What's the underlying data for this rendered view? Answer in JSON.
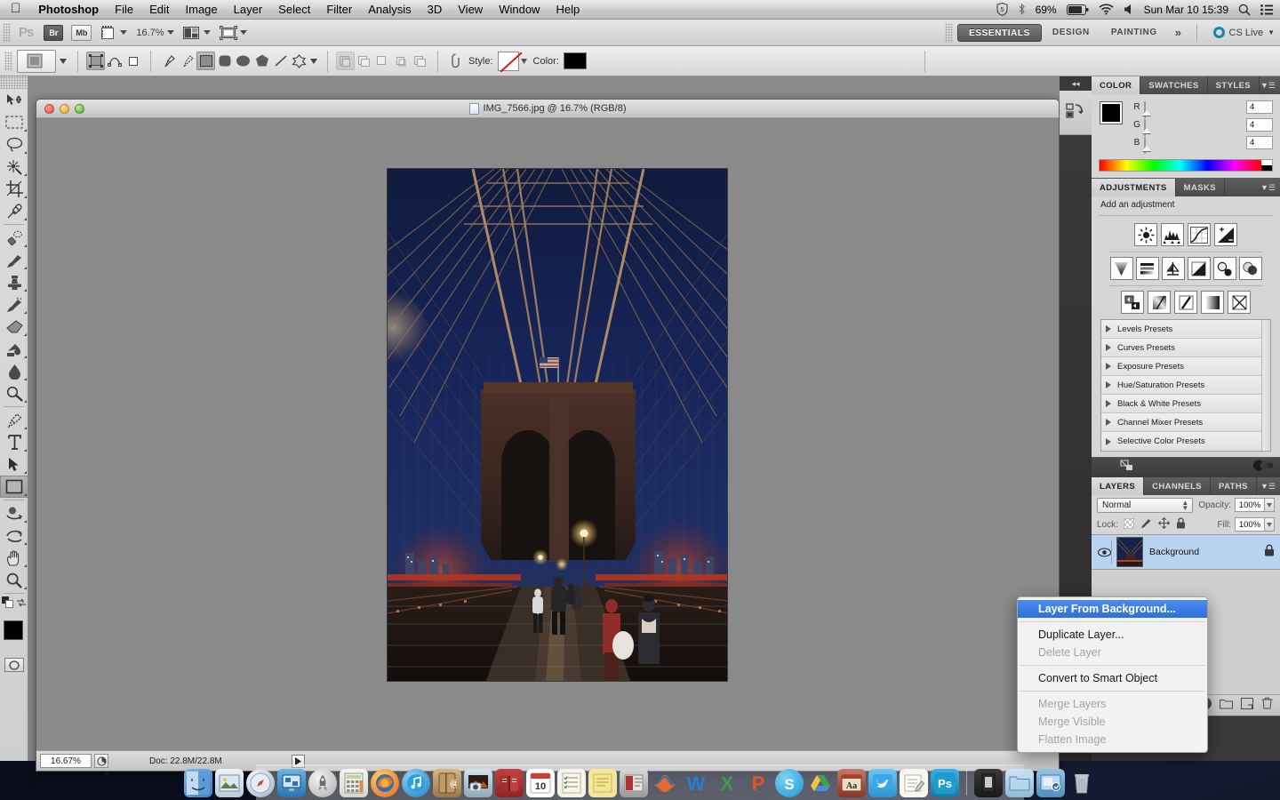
{
  "menubar": {
    "apple_icon": "apple-icon",
    "app_name": "Photoshop",
    "items": [
      "File",
      "Edit",
      "Image",
      "Layer",
      "Select",
      "Filter",
      "Analysis",
      "3D",
      "View",
      "Window",
      "Help"
    ],
    "status": {
      "shield_icon": "dropbox-shield-icon",
      "bluetooth_icon": "bluetooth-icon",
      "battery_percent": "69%",
      "battery_icon": "battery-icon",
      "wifi_icon": "wifi-icon",
      "volume_icon": "volume-icon",
      "clock": "Sun Mar 10  15:39",
      "search_icon": "spotlight-search-icon",
      "list_icon": "notification-center-icon"
    }
  },
  "appbar": {
    "ps_logo": "Ps",
    "bridge_label": "Br",
    "minibridge_label": "Mb",
    "view_extras_icon": "view-extras-icon",
    "zoom_level": "16.7%",
    "arrange_icon": "arrange-documents-icon",
    "screenmode_icon": "screen-mode-icon",
    "workspaces": [
      {
        "label": "ESSENTIALS",
        "active": true
      },
      {
        "label": "DESIGN",
        "active": false
      },
      {
        "label": "PAINTING",
        "active": false
      }
    ],
    "more_icon": "chevron-double-right-icon",
    "cs_live_label": "CS Live",
    "cs_live_icon": "cs-live-ring-icon"
  },
  "optionsbar": {
    "tool_preset_icon": "rectangle-shape-preset-icon",
    "preset_caret_icon": "caret-down-icon",
    "mode_buttons": [
      {
        "name": "shape-layers-mode",
        "active": true
      },
      {
        "name": "paths-mode",
        "active": false
      },
      {
        "name": "fill-pixels-mode",
        "active": false
      }
    ],
    "shape_tools": [
      {
        "name": "pen-tool-icon",
        "active": false
      },
      {
        "name": "freeform-pen-tool-icon",
        "active": false
      },
      {
        "name": "rectangle-tool-icon",
        "active": true
      },
      {
        "name": "rounded-rectangle-tool-icon",
        "active": false
      },
      {
        "name": "ellipse-tool-icon",
        "active": false
      },
      {
        "name": "polygon-tool-icon",
        "active": false
      },
      {
        "name": "line-tool-icon",
        "active": false
      },
      {
        "name": "custom-shape-tool-icon",
        "active": false
      }
    ],
    "shape_caret_icon": "caret-down-icon",
    "path_ops": [
      {
        "name": "add-to-shape-area-icon",
        "active": true
      },
      {
        "name": "subtract-from-shape-area-icon",
        "active": false
      },
      {
        "name": "intersect-shape-areas-icon",
        "active": false
      },
      {
        "name": "exclude-overlapping-icon",
        "active": false
      },
      {
        "name": "combine-shape-icon",
        "active": false
      }
    ],
    "link_icon": "layer-style-link-icon",
    "style_label": "Style:",
    "style_value": "none",
    "style_caret_icon": "caret-down-icon",
    "color_label": "Color:",
    "color_value": "#000000"
  },
  "toolbar": {
    "tools": [
      {
        "name": "move-tool",
        "selected": false,
        "more": false
      },
      {
        "name": "rectangular-marquee-tool",
        "selected": false,
        "more": true
      },
      {
        "name": "lasso-tool",
        "selected": false,
        "more": true
      },
      {
        "name": "quick-selection-tool",
        "selected": false,
        "more": true
      },
      {
        "name": "crop-tool",
        "selected": false,
        "more": true
      },
      {
        "name": "eyedropper-tool",
        "selected": false,
        "more": true
      },
      {
        "name": "spot-healing-brush-tool",
        "selected": false,
        "more": true
      },
      {
        "name": "brush-tool",
        "selected": false,
        "more": true
      },
      {
        "name": "clone-stamp-tool",
        "selected": false,
        "more": true
      },
      {
        "name": "history-brush-tool",
        "selected": false,
        "more": true
      },
      {
        "name": "eraser-tool",
        "selected": false,
        "more": true
      },
      {
        "name": "gradient-tool",
        "selected": false,
        "more": true
      },
      {
        "name": "blur-tool",
        "selected": false,
        "more": true
      },
      {
        "name": "dodge-tool",
        "selected": false,
        "more": true
      },
      {
        "name": "pen-tool",
        "selected": false,
        "more": true
      },
      {
        "name": "horizontal-type-tool",
        "selected": false,
        "more": true
      },
      {
        "name": "path-selection-tool",
        "selected": false,
        "more": true
      },
      {
        "name": "rectangle-shape-tool",
        "selected": true,
        "more": true
      },
      {
        "name": "3d-object-rotate-tool",
        "selected": false,
        "more": true
      },
      {
        "name": "3d-camera-rotate-tool",
        "selected": false,
        "more": true
      },
      {
        "name": "hand-tool",
        "selected": false,
        "more": true
      },
      {
        "name": "zoom-tool",
        "selected": false,
        "more": true
      }
    ],
    "foreground_color": "#000000",
    "background_color": "#ffffff",
    "swap_colors_icon": "swap-colors-icon",
    "default_colors_icon": "default-colors-icon",
    "quick_mask_icon": "quick-mask-mode-icon"
  },
  "document": {
    "title": "IMG_7566.jpg @ 16.7% (RGB/8)",
    "file_icon": "document-thumbnail-icon",
    "close_button": "close-window-button",
    "minimize_button": "minimize-window-button",
    "zoom_button": "zoom-window-button",
    "status": {
      "zoom": "16.67%",
      "zoom_menu_icon": "zoom-options-icon",
      "doc_size": "Doc: 22.8M/22.8M",
      "arrow_icon": "status-arrow-icon"
    },
    "image_alt": "Brooklyn Bridge walkway at dusk with cables, tower and pedestrians"
  },
  "color_panel": {
    "tabs": [
      {
        "label": "COLOR",
        "active": true
      },
      {
        "label": "SWATCHES",
        "active": false
      },
      {
        "label": "STYLES",
        "active": false
      }
    ],
    "menu_icon": "panel-menu-icon",
    "channels": [
      {
        "label": "R",
        "value": "4"
      },
      {
        "label": "G",
        "value": "4"
      },
      {
        "label": "B",
        "value": "4"
      }
    ],
    "foreground_color": "#000000",
    "background_color": "#ffffff"
  },
  "adjustments_panel": {
    "tabs": [
      {
        "label": "ADJUSTMENTS",
        "active": true
      },
      {
        "label": "MASKS",
        "active": false
      }
    ],
    "menu_icon": "panel-menu-icon",
    "heading": "Add an adjustment",
    "row1_icons": [
      "brightness-contrast-icon",
      "levels-icon",
      "curves-icon",
      "exposure-icon"
    ],
    "row2_icons": [
      "vibrance-icon",
      "hue-saturation-icon",
      "color-balance-icon",
      "black-and-white-icon",
      "photo-filter-icon",
      "channel-mixer-icon"
    ],
    "row3_icons": [
      "invert-icon",
      "posterize-icon",
      "threshold-icon",
      "gradient-map-icon",
      "selective-color-icon"
    ],
    "presets": [
      "Levels Presets",
      "Curves Presets",
      "Exposure Presets",
      "Hue/Saturation Presets",
      "Black & White Presets",
      "Channel Mixer Presets",
      "Selective Color Presets"
    ]
  },
  "layers_panel": {
    "dock_icons": [
      "history-panel-icon",
      "color-panel-icon"
    ],
    "tabs": [
      {
        "label": "LAYERS",
        "active": true
      },
      {
        "label": "CHANNELS",
        "active": false
      },
      {
        "label": "PATHS",
        "active": false
      }
    ],
    "menu_icon": "panel-menu-icon",
    "blend_mode": "Normal",
    "opacity_label": "Opacity:",
    "opacity_value": "100%",
    "lock_label": "Lock:",
    "lock_icons": [
      "lock-transparent-pixels-icon",
      "lock-image-pixels-icon",
      "lock-position-icon",
      "lock-all-icon"
    ],
    "fill_label": "Fill:",
    "fill_value": "100%",
    "layers": [
      {
        "name": "Background",
        "visible": true,
        "locked": true,
        "selected": true
      }
    ],
    "footer_icons": [
      "link-layers-icon",
      "layer-style-icon",
      "layer-mask-icon",
      "new-fill-adjustment-icon",
      "new-group-icon",
      "new-layer-icon",
      "delete-layer-icon"
    ]
  },
  "context_menu": {
    "items": [
      {
        "label": "Layer From Background...",
        "state": "highlighted"
      },
      {
        "label": "separator",
        "state": "separator"
      },
      {
        "label": "Duplicate Layer...",
        "state": "enabled"
      },
      {
        "label": "Delete Layer",
        "state": "disabled"
      },
      {
        "label": "separator",
        "state": "separator"
      },
      {
        "label": "Convert to Smart Object",
        "state": "enabled"
      },
      {
        "label": "separator",
        "state": "separator"
      },
      {
        "label": "Merge Layers",
        "state": "disabled"
      },
      {
        "label": "Merge Visible",
        "state": "disabled"
      },
      {
        "label": "Flatten Image",
        "state": "disabled"
      }
    ],
    "highlight_color": "#2f6fd8"
  },
  "dock": {
    "items": [
      {
        "name": "finder-icon",
        "glyph": "☺",
        "bg": "#4f92d4"
      },
      {
        "name": "preview-icon",
        "glyph": "🖼",
        "bg": "#b7c8d8"
      },
      {
        "name": "safari-icon",
        "glyph": "❁",
        "bg": "#d6dde4"
      },
      {
        "name": "remote-desktop-icon",
        "glyph": "❐",
        "bg": "#2f7fc4"
      },
      {
        "name": "launchpad-icon",
        "glyph": "🚀",
        "bg": "#c9c9c9"
      },
      {
        "name": "calculator-icon",
        "glyph": "⊞",
        "bg": "#e8e8e4"
      },
      {
        "name": "firefox-icon",
        "glyph": "◉",
        "bg": "#e8762a"
      },
      {
        "name": "itunes-icon",
        "glyph": "♪",
        "bg": "#3aa3e3"
      },
      {
        "name": "address-book-icon",
        "glyph": "@",
        "bg": "#b98f58"
      },
      {
        "name": "iphoto-icon",
        "glyph": "❖",
        "bg": "#9fb6c9"
      },
      {
        "name": "dictionary-icon",
        "glyph": "▤",
        "bg": "#b03030"
      },
      {
        "name": "calendar-icon",
        "glyph": "10",
        "bg": "#f2f2f2"
      },
      {
        "name": "reminders-icon",
        "glyph": "✓",
        "bg": "#f4f1e6"
      },
      {
        "name": "stickies-icon",
        "glyph": "▧",
        "bg": "#f0e49a"
      },
      {
        "name": "textmate-icon",
        "glyph": "☰",
        "bg": "#8b2a2a"
      },
      {
        "name": "matlab-icon",
        "glyph": "∿",
        "bg": "#e06a2b"
      },
      {
        "name": "word-icon",
        "glyph": "W",
        "bg": "#2b7cd3"
      },
      {
        "name": "excel-icon",
        "glyph": "X",
        "bg": "#3f9b47"
      },
      {
        "name": "powerpoint-icon",
        "glyph": "P",
        "bg": "#e0582a"
      },
      {
        "name": "skype-icon",
        "glyph": "S",
        "bg": "#2aa8e0"
      },
      {
        "name": "google-drive-icon",
        "glyph": "▲",
        "bg": "#3fa14a"
      },
      {
        "name": "dictionary-aa-icon",
        "glyph": "Aa",
        "bg": "#a8402c"
      },
      {
        "name": "twitter-icon",
        "glyph": "✉",
        "bg": "#3aa8e8"
      },
      {
        "name": "notes-icon",
        "glyph": "✎",
        "bg": "#f2f2ee"
      },
      {
        "name": "photoshop-icon",
        "glyph": "Ps",
        "bg": "#2196c9"
      },
      {
        "name": "dock-separator",
        "glyph": "",
        "bg": ""
      },
      {
        "name": "documents-stack-icon",
        "glyph": "▮",
        "bg": "#2a2a2a"
      },
      {
        "name": "downloads-folder-icon",
        "glyph": "▱",
        "bg": "#a8cde8"
      },
      {
        "name": "screenshots-folder-icon",
        "glyph": "▣",
        "bg": "#7fb4dd"
      },
      {
        "name": "trash-icon",
        "glyph": "⌧",
        "bg": "#c6ccd2"
      }
    ]
  }
}
